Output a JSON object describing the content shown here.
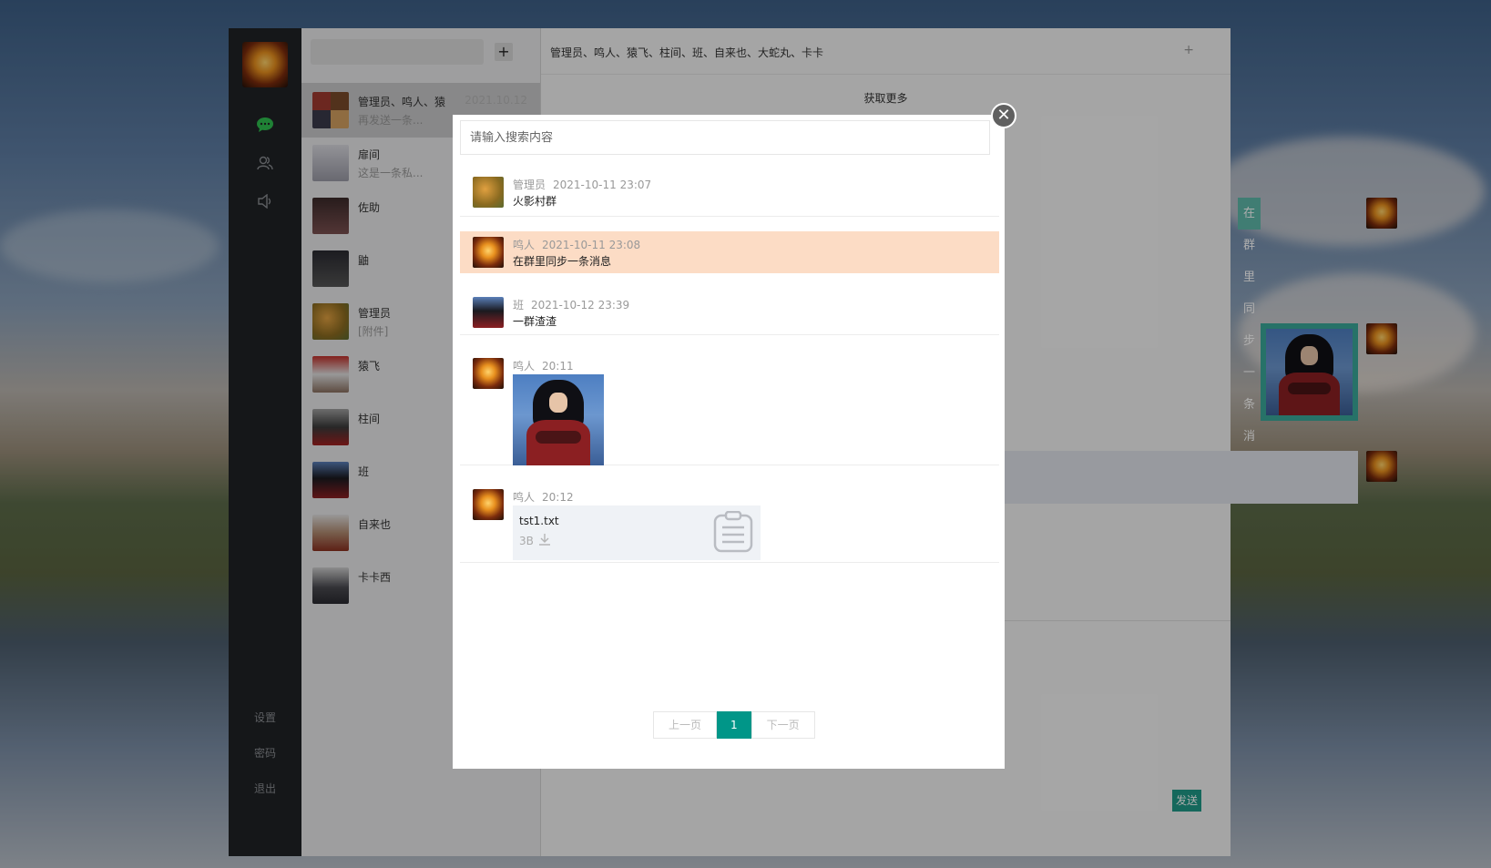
{
  "sidebar": {
    "bottom_links": [
      "设置",
      "密码",
      "退出"
    ]
  },
  "contacts": [
    {
      "name": "管理员、鸣人、猿",
      "sub": "再发送一条...",
      "time": "2021.10.12",
      "active": true
    },
    {
      "name": "扉间",
      "sub": "这是一条私...",
      "time": ""
    },
    {
      "name": "佐助",
      "sub": "",
      "time": ""
    },
    {
      "name": "鼬",
      "sub": "",
      "time": ""
    },
    {
      "name": "管理员",
      "sub": "[附件]",
      "time": ""
    },
    {
      "name": "猿飞",
      "sub": "",
      "time": ""
    },
    {
      "name": "柱间",
      "sub": "",
      "time": ""
    },
    {
      "name": "班",
      "sub": "",
      "time": ""
    },
    {
      "name": "自来也",
      "sub": "",
      "time": ""
    },
    {
      "name": "卡卡西",
      "sub": "",
      "time": ""
    }
  ],
  "chat": {
    "title": "管理员、鸣人、猿飞、柱间、班、自来也、大蛇丸、卡卡",
    "more_label": "+",
    "fetch_more": "获取更多",
    "sync_message": "在群里同步一条消息",
    "send_label": "发送"
  },
  "search_modal": {
    "placeholder": "请输入搜索内容",
    "close_label": "✕",
    "results": [
      {
        "sender": "管理员",
        "time": "2021-10-11 23:07",
        "text": "火影村群"
      },
      {
        "sender": "鸣人",
        "time": "2021-10-11 23:08",
        "text": "在群里同步一条消息"
      },
      {
        "sender": "班",
        "time": "2021-10-12 23:39",
        "text": "一群渣渣"
      },
      {
        "sender": "鸣人",
        "time": "20:11",
        "text": ""
      },
      {
        "sender": "鸣人",
        "time": "20:12",
        "file_name": "tst1.txt",
        "file_size": "3B"
      }
    ],
    "pager": {
      "prev": "上一页",
      "current": "1",
      "next": "下一页"
    }
  },
  "colors": {
    "accent": "#009688",
    "highlight": "#fcdcc5",
    "sidebar_bg": "#1f2226",
    "bubble": "#5fb8aa"
  }
}
